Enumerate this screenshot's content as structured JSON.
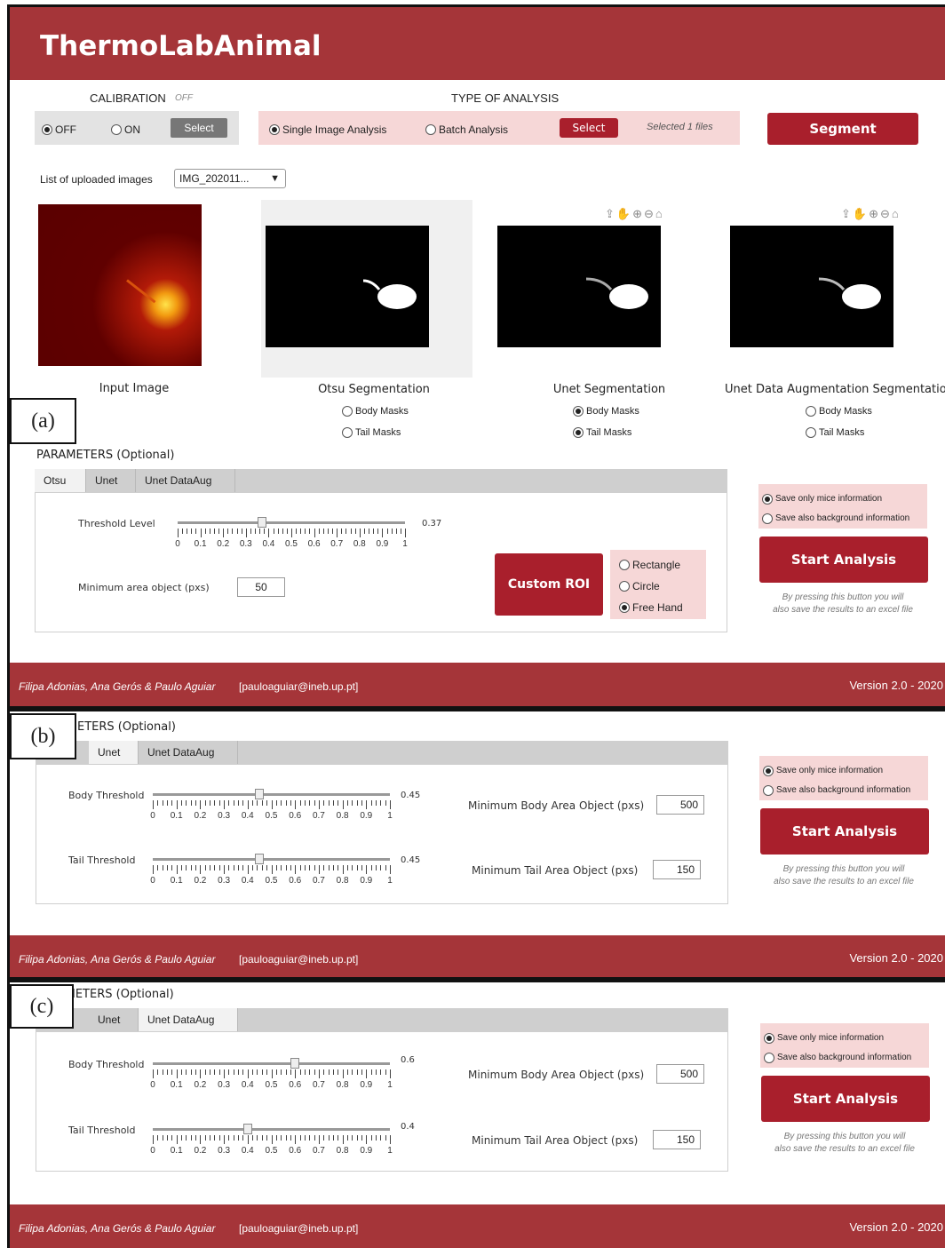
{
  "app": {
    "title": "ThermoLabAnimal"
  },
  "calibration": {
    "label": "CALIBRATION",
    "status": "OFF",
    "opt_off": "OFF",
    "opt_on": "ON",
    "select": "Select"
  },
  "analysis": {
    "label": "TYPE OF ANALYSIS",
    "single": "Single Image Analysis",
    "batch": "Batch Analysis",
    "select": "Select",
    "selected": "Selected 1 files"
  },
  "segment_button": "Segment",
  "uploaded": {
    "label": "List of uploaded images",
    "value": "IMG_202011..."
  },
  "images": [
    {
      "caption": "Input Image"
    },
    {
      "caption": "Otsu Segmentation",
      "opt1": "Body Masks",
      "opt2": "Tail Masks"
    },
    {
      "caption": "Unet Segmentation",
      "opt1": "Body Masks",
      "opt2": "Tail Masks"
    },
    {
      "caption": "Unet Data Augmentation Segmentation",
      "opt1": "Body Masks",
      "opt2": "Tail Masks"
    }
  ],
  "params": {
    "title_full": "PARAMETERS (Optional)",
    "title_cut_b": "ETERS (Optional)",
    "title_cut_c": "IETERS (Optional)",
    "tabs": [
      "Otsu",
      "Unet",
      "Unet DataAug"
    ],
    "threshold_label": "Threshold Level",
    "threshold_value": 0.37,
    "threshold_text": "0.37",
    "min_area_label": "Minimum area object (pxs)",
    "min_area": "50",
    "custom_roi": "Custom ROI",
    "roi_opts": [
      "Rectangle",
      "Circle",
      "Free Hand"
    ],
    "body_threshold_label": "Body Threshold",
    "tail_threshold_label": "Tail Threshold",
    "min_body_label": "Minimum Body Area Object (pxs)",
    "min_tail_label": "Minimum Tail Area Object (pxs)",
    "b": {
      "body": 0.45,
      "body_text": "0.45",
      "tail": 0.45,
      "tail_text": "0.45",
      "min_body": "500",
      "min_tail": "150"
    },
    "c": {
      "body": 0.6,
      "body_text": "0.6",
      "tail": 0.4,
      "tail_text": "0.4",
      "min_body": "500",
      "min_tail": "150"
    }
  },
  "tick_labels": [
    "0",
    "0.1",
    "0.2",
    "0.3",
    "0.4",
    "0.5",
    "0.6",
    "0.7",
    "0.8",
    "0.9",
    "1"
  ],
  "save": {
    "opt1": "Save only mice information",
    "opt2": "Save also background information",
    "start": "Start Analysis",
    "note1": "By pressing this button you will",
    "note2": "also save the results to an excel file"
  },
  "footer": {
    "authors": "Filipa Adonias, Ana Gerós & Paulo Aguiar",
    "email": "[pauloaguiar@ineb.up.pt]",
    "version": "Version 2.0 - 2020"
  },
  "tags": {
    "a": "(a)",
    "b": "(b)",
    "c": "(c)"
  },
  "colors": {
    "brand": "#a53539",
    "button": "#a91f2c",
    "pink": "#f6d7d7"
  }
}
